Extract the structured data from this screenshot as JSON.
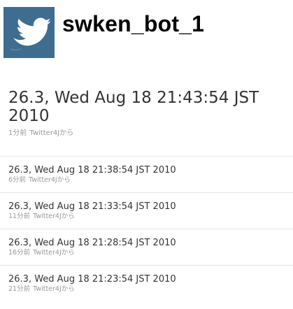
{
  "profile": {
    "username": "swken_bot_1",
    "avatar_icon": "twitter-bird-icon",
    "avatar_color": "#3e6d8f"
  },
  "latest_status": {
    "text": "26.3, Wed Aug 18 21:43:54 JST 2010",
    "time_ago": "1分前",
    "source": "Twitter4Jから"
  },
  "timeline": [
    {
      "text": "26.3, Wed Aug 18 21:38:54 JST 2010",
      "time_ago": "6分前",
      "source": "Twitter4Jから"
    },
    {
      "text": "26.3, Wed Aug 18 21:33:54 JST 2010",
      "time_ago": "11分前",
      "source": "Twitter4Jから"
    },
    {
      "text": "26.3, Wed Aug 18 21:28:54 JST 2010",
      "time_ago": "16分前",
      "source": "Twitter4Jから"
    },
    {
      "text": "26.3, Wed Aug 18 21:23:54 JST 2010",
      "time_ago": "21分前",
      "source": "Twitter4Jから"
    }
  ]
}
